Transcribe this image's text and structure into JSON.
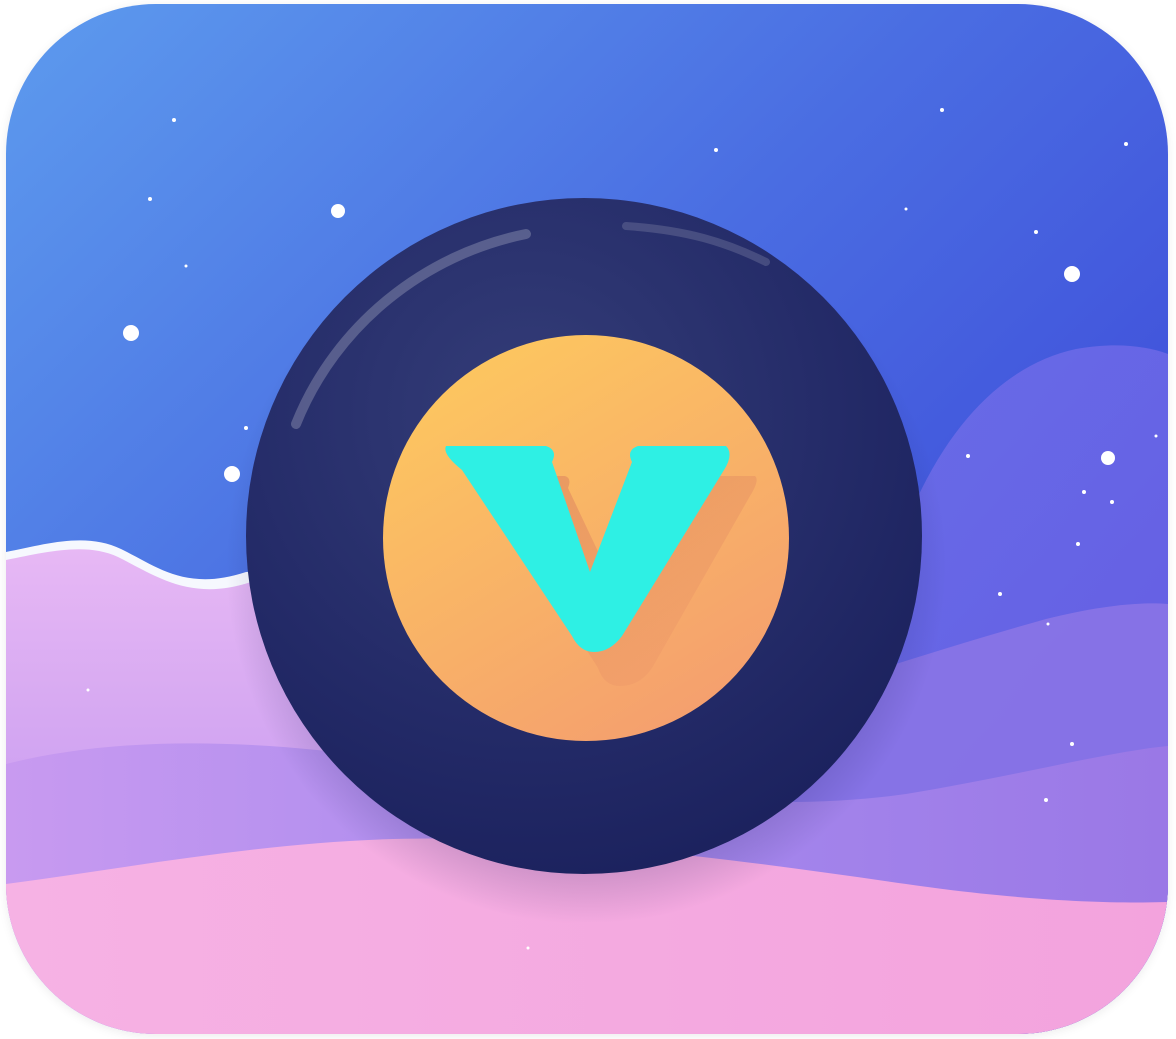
{
  "app_icon": {
    "name": "V app icon",
    "letter": "V",
    "colors": {
      "sky_top_left": "#5a95ec",
      "sky_top_right": "#3a4ad8",
      "sky_mid": "#5a63e6",
      "wave_back": "#7a6fe8",
      "wave_mid": "#a486ec",
      "wave_front_left": "#e8b3f2",
      "wave_bottom": "#f7a8dc",
      "ring_outer": "#27306a",
      "ring_inner": "#1e2462",
      "disc_top": "#fbc462",
      "disc_bottom": "#f4a06c",
      "letter_color": "#2ef0e4"
    },
    "icons": [
      "star-dot-icon",
      "hill-wave-icon",
      "letter-v-icon",
      "orange-disc-icon",
      "dark-ring-icon"
    ]
  }
}
